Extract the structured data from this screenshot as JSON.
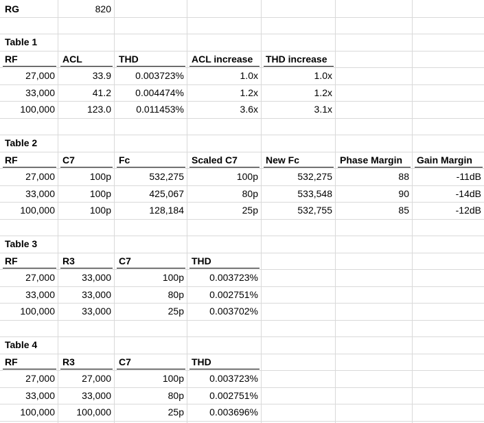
{
  "rg": {
    "label": "RG",
    "value": "820"
  },
  "tables": [
    {
      "title": "Table 1",
      "headers": [
        "RF",
        "ACL",
        "THD",
        "ACL increase",
        "THD increase"
      ],
      "rows": [
        [
          "27,000",
          "33.9",
          "0.003723%",
          "1.0x",
          "1.0x"
        ],
        [
          "33,000",
          "41.2",
          "0.004474%",
          "1.2x",
          "1.2x"
        ],
        [
          "100,000",
          "123.0",
          "0.011453%",
          "3.6x",
          "3.1x"
        ]
      ]
    },
    {
      "title": "Table 2",
      "headers": [
        "RF",
        "C7",
        "Fc",
        "Scaled C7",
        "New Fc",
        "Phase Margin",
        "Gain Margin"
      ],
      "rows": [
        [
          "27,000",
          "100p",
          "532,275",
          "100p",
          "532,275",
          "88",
          "-11dB"
        ],
        [
          "33,000",
          "100p",
          "425,067",
          "80p",
          "533,548",
          "90",
          "-14dB"
        ],
        [
          "100,000",
          "100p",
          "128,184",
          "25p",
          "532,755",
          "85",
          "-12dB"
        ]
      ]
    },
    {
      "title": "Table 3",
      "headers": [
        "RF",
        "R3",
        "C7",
        "THD"
      ],
      "rows": [
        [
          "27,000",
          "33,000",
          "100p",
          "0.003723%"
        ],
        [
          "33,000",
          "33,000",
          "80p",
          "0.002751%"
        ],
        [
          "100,000",
          "33,000",
          "25p",
          "0.003702%"
        ]
      ]
    },
    {
      "title": "Table 4",
      "headers": [
        "RF",
        "R3",
        "C7",
        "THD"
      ],
      "rows": [
        [
          "27,000",
          "27,000",
          "100p",
          "0.003723%"
        ],
        [
          "33,000",
          "33,000",
          "80p",
          "0.002751%"
        ],
        [
          "100,000",
          "100,000",
          "25p",
          "0.003696%"
        ]
      ]
    }
  ]
}
